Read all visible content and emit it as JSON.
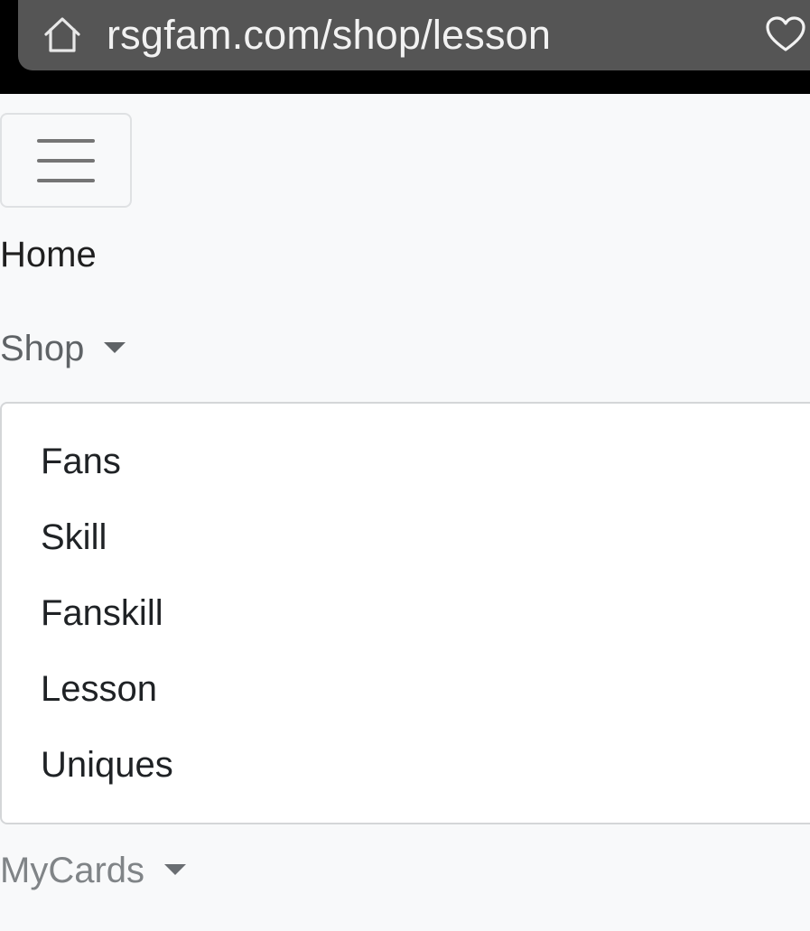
{
  "browser": {
    "url": "rsgfam.com/shop/lesson",
    "home_icon": "home-icon",
    "favorite_icon": "heart-icon"
  },
  "navbar": {
    "toggler_icon": "hamburger-menu-icon",
    "home_label": "Home",
    "shop_label": "Shop",
    "shop_items": [
      "Fans",
      "Skill",
      "Fanskill",
      "Lesson",
      "Uniques"
    ],
    "mycards_label": "MyCards"
  },
  "colors": {
    "chrome_background": "#000000",
    "url_bar": "#555555",
    "page_background": "#f8f9fa",
    "dropdown_background": "#ffffff"
  }
}
